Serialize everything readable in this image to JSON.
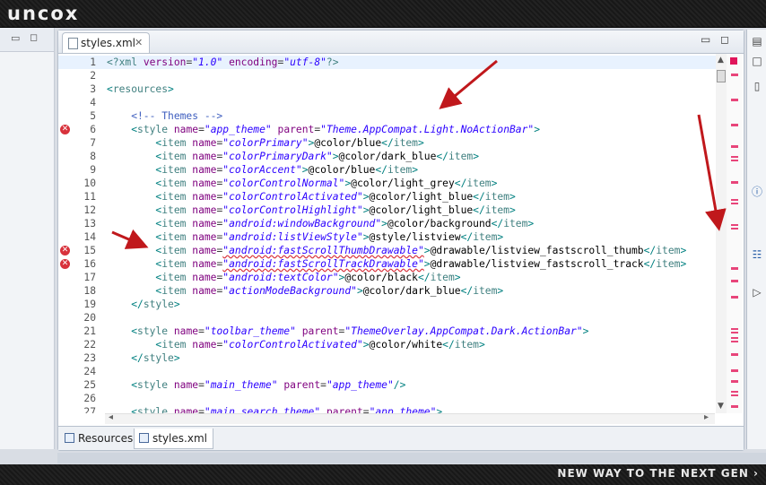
{
  "brand": {
    "logo": "uncox"
  },
  "footer": {
    "tagline": "NEW WAY TO THE NEXT GEN ›"
  },
  "editor": {
    "tab_label": "styles.xml",
    "bottom_tabs": [
      {
        "label": "Resources"
      },
      {
        "label": "styles.xml"
      }
    ]
  },
  "code_lines": [
    {
      "n": "1",
      "text": "<?xml version=\"1.0\" encoding=\"utf-8\"?>",
      "error": false
    },
    {
      "n": "2",
      "text": "",
      "error": false
    },
    {
      "n": "3",
      "text": "<resources>",
      "error": false
    },
    {
      "n": "4",
      "text": "",
      "error": false
    },
    {
      "n": "5",
      "text": "    <!-- Themes -->",
      "error": false
    },
    {
      "n": "6",
      "text": "    <style name=\"app_theme\" parent=\"Theme.AppCompat.Light.NoActionBar\">",
      "error": true
    },
    {
      "n": "7",
      "text": "        <item name=\"colorPrimary\">@color/blue</item>",
      "error": false
    },
    {
      "n": "8",
      "text": "        <item name=\"colorPrimaryDark\">@color/dark_blue</item>",
      "error": false
    },
    {
      "n": "9",
      "text": "        <item name=\"colorAccent\">@color/blue</item>",
      "error": false
    },
    {
      "n": "10",
      "text": "        <item name=\"colorControlNormal\">@color/light_grey</item>",
      "error": false
    },
    {
      "n": "11",
      "text": "        <item name=\"colorControlActivated\">@color/light_blue</item>",
      "error": false
    },
    {
      "n": "12",
      "text": "        <item name=\"colorControlHighlight\">@color/light_blue</item>",
      "error": false
    },
    {
      "n": "13",
      "text": "        <item name=\"android:windowBackground\">@color/background</item>",
      "error": false
    },
    {
      "n": "14",
      "text": "        <item name=\"android:listViewStyle\">@style/listview</item>",
      "error": false
    },
    {
      "n": "15",
      "text": "        <item name=\"android:fastScrollThumbDrawable\">@drawable/listview_fastscroll_thumb</item>",
      "error": true
    },
    {
      "n": "16",
      "text": "        <item name=\"android:fastScrollTrackDrawable\">@drawable/listview_fastscroll_track</item>",
      "error": true
    },
    {
      "n": "17",
      "text": "        <item name=\"android:textColor\">@color/black</item>",
      "error": false
    },
    {
      "n": "18",
      "text": "        <item name=\"actionModeBackground\">@color/dark_blue</item>",
      "error": false
    },
    {
      "n": "19",
      "text": "    </style>",
      "error": false
    },
    {
      "n": "20",
      "text": "",
      "error": false
    },
    {
      "n": "21",
      "text": "    <style name=\"toolbar_theme\" parent=\"ThemeOverlay.AppCompat.Dark.ActionBar\">",
      "error": false
    },
    {
      "n": "22",
      "text": "        <item name=\"colorControlActivated\">@color/white</item>",
      "error": false
    },
    {
      "n": "23",
      "text": "    </style>",
      "error": false
    },
    {
      "n": "24",
      "text": "",
      "error": false
    },
    {
      "n": "25",
      "text": "    <style name=\"main_theme\" parent=\"app_theme\"/>",
      "error": false
    },
    {
      "n": "26",
      "text": "",
      "error": false
    },
    {
      "n": "27",
      "text": "    <style name=\"main_search_theme\" parent=\"app_theme\">",
      "error": false
    }
  ],
  "colors": {
    "error": "#d8323c",
    "annotation_arrow": "#c0181c",
    "ruler_marker": "#e8457a",
    "current_line": "#e8f2fe"
  },
  "icons": {
    "error": "error-icon",
    "close": "close-icon",
    "minimize": "minimize-icon",
    "maximize": "maximize-icon"
  }
}
